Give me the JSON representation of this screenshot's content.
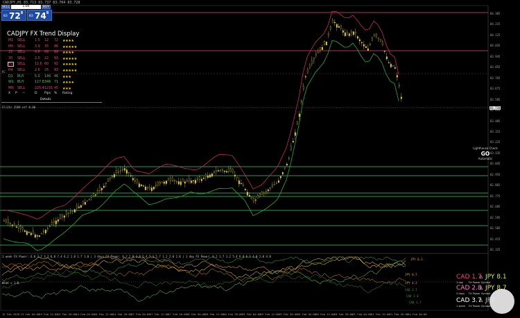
{
  "header": {
    "symbol_line": "CADJPY,H1  83.713 83.737 83.704 83.728"
  },
  "trade_panel": {
    "sell_label": "SELL",
    "buy_label": "BUY",
    "lot": "1.00",
    "bid_small": "83",
    "bid_big": "72",
    "bid_sup": "8",
    "ask_small": "83",
    "ask_big": "74",
    "ask_sup": "8"
  },
  "trend_display": {
    "title": "CADJPY FX Trend Display",
    "rows": [
      {
        "tf": "M1",
        "signal": "SELL",
        "a": "1.5",
        "b": "12",
        "pct": "72",
        "stars": "★★★★",
        "color": "#e0457f"
      },
      {
        "tf": "M5",
        "signal": "SELL",
        "a": "3.9",
        "b": "35",
        "pct": "86",
        "stars": "★★★★★",
        "color": "#e0457f"
      },
      {
        "tf": "15",
        "signal": "SELL",
        "a": "4.6",
        "b": "49",
        "pct": "89",
        "stars": "★★★★",
        "color": "#e0457f"
      },
      {
        "tf": "30",
        "signal": "SELL",
        "a": "2.0",
        "b": "22",
        "pct": "93",
        "stars": "★★★★★",
        "color": "#e0457f"
      },
      {
        "tf": "H1",
        "signal": "SELL",
        "a": "12.6",
        "b": "60",
        "pct": "92",
        "stars": "★★★★★",
        "color": "#e0457f",
        "selected": true
      },
      {
        "tf": "H4",
        "signal": "SELL",
        "a": "2.6",
        "b": "26",
        "pct": "83",
        "stars": "★★★★★",
        "color": "#e0457f"
      },
      {
        "tf": "D1",
        "signal": "BUY",
        "a": "5.0",
        "b": "146",
        "pct": "46",
        "stars": "★★★",
        "color": "#55cc44"
      },
      {
        "tf": "W1",
        "signal": "BUY",
        "a": "127.8",
        "b": "346",
        "pct": "71",
        "stars": "★★★★",
        "color": "#55cc44"
      },
      {
        "tf": "MN",
        "signal": "SELL",
        "a": "225.4",
        "b": "1231",
        "pct": "45",
        "stars": "★★★",
        "color": "#e0457f"
      }
    ],
    "footer": {
      "a": "X",
      "b": "P",
      "c": "—",
      "d": "D",
      "e": "Pips",
      "f": "%",
      "g": "Rating"
    },
    "details": "Details"
  },
  "chart": {
    "rc_label": "RC",
    "fc_label": "FC(2h) 2589 ntf 0.00",
    "price_ticks": [
      "84.305",
      "84.215",
      "84.125",
      "84.035",
      "83.945",
      "83.855",
      "83.765",
      "83.675",
      "83.585",
      "83.495",
      "83.405",
      "83.315",
      "83.225",
      "83.135",
      "83.045",
      "82.955",
      "82.865",
      "82.775",
      "82.685",
      "82.595",
      "82.505",
      "82.415",
      "82.325"
    ],
    "current_price": "83.728",
    "time_ticks": [
      "12 Feb 2020",
      "13 Feb 04:00",
      "13 Feb 12:00",
      "13 Feb 20:00",
      "14 Feb 04:00",
      "14 Feb 12:00",
      "14 Feb 20:00",
      "17 Feb 04:00",
      "17 Feb 12:00",
      "17 Feb 20:00",
      "18 Feb 04:00",
      "18 Feb 12:00",
      "18 Feb 20:00",
      "19 Feb 04:00",
      "19 Feb 12:00",
      "19 Feb 20:00",
      "20 Feb 04:00",
      "20 Feb 12:00",
      "20 Feb 20:00",
      "21 Feb 04:00",
      "21 Feb 12:00",
      "21 Feb 20:00",
      "24 Feb 04:00"
    ],
    "colors": {
      "bull": "#e8d23a",
      "support": "#2fae2f",
      "resistance": "#c8285e",
      "hline_green": "#3acb6a",
      "hline_red": "#e04a7a"
    }
  },
  "lighthouse": {
    "title": "Lighthouse Check",
    "go": "GO",
    "mode": "Automatic"
  },
  "sub_panel": {
    "title": "1 week FX Power: 6.8 3.7 3.2 6.8 7.4 6.2 1.8 1.7 1.8  |  3 days FX Power: 6.2 2.8 3.8 6.4 7.1 5.7 1.2 2.0 2.8  |  1 day FX Power: 6.2 1.7 1.2 5.4 6.8 6.1 4.0 2.0 4.8",
    "label": "Weak < 1.8",
    "tags": [
      {
        "text": "JPY 8.1",
        "color": "#e0a020"
      },
      {
        "text": "JPY 8.7",
        "color": "#e0a020"
      },
      {
        "text": "JPY 4.2",
        "color": "#e0a020"
      },
      {
        "text": "CAD 2.7",
        "color": "#3a9a3a"
      },
      {
        "text": "CAD 2.8",
        "color": "#3a9a3a"
      },
      {
        "text": "CAD 1.7",
        "color": "#3a9a3a"
      }
    ],
    "fx_power": [
      {
        "cad": "CAD 1.7",
        "jpy": "JPY 8.1",
        "cad_color": "#ff3d7f",
        "jpy_color": "#c6f03a",
        "period": "1 day",
        "label": "FX Power",
        "symbol": "Symbol"
      },
      {
        "cad": "CAD 2.8",
        "jpy": "JPY 8.7",
        "cad_color": "#ff7ac8",
        "jpy_color": "#e8e040",
        "period": "3 days",
        "label": "FX Power",
        "symbol": "Symbol"
      },
      {
        "cad": "CAD 3.7",
        "jpy": "JPY",
        "cad_color": "#ffffff",
        "jpy_color": "#cccccc",
        "period": "1 week",
        "label": "FX Power",
        "symbol": "Symbol"
      }
    ],
    "delta_symbol": "Δ"
  }
}
